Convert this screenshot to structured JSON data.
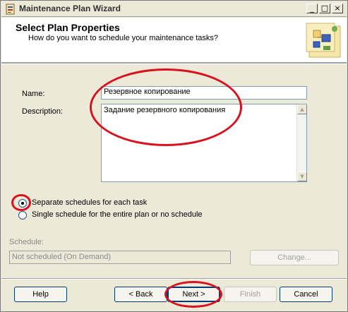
{
  "window": {
    "title": "Maintenance Plan Wizard",
    "controls": [
      "_",
      "□",
      "×"
    ]
  },
  "header": {
    "title": "Select Plan Properties",
    "subtitle": "How do you want to schedule your maintenance tasks?",
    "art_icon": "wizard-graphic-icon"
  },
  "form": {
    "name_label": "Name:",
    "name_value": "Резервное копирование",
    "description_label": "Description:",
    "description_value": "Задание резервного копирования"
  },
  "schedule_options": {
    "selected": "separate",
    "separate_label": "Separate schedules for each task",
    "single_label": "Single schedule for the entire plan or no schedule"
  },
  "schedule": {
    "label": "Schedule:",
    "value": "Not scheduled (On Demand)",
    "change_label": "Change..."
  },
  "footer": {
    "help_label": "Help",
    "back_label": "< Back",
    "next_label": "Next >",
    "finish_label": "Finish",
    "cancel_label": "Cancel"
  },
  "colors": {
    "annotation": "#d8121f",
    "dialog_bg": "#ece9d8"
  }
}
